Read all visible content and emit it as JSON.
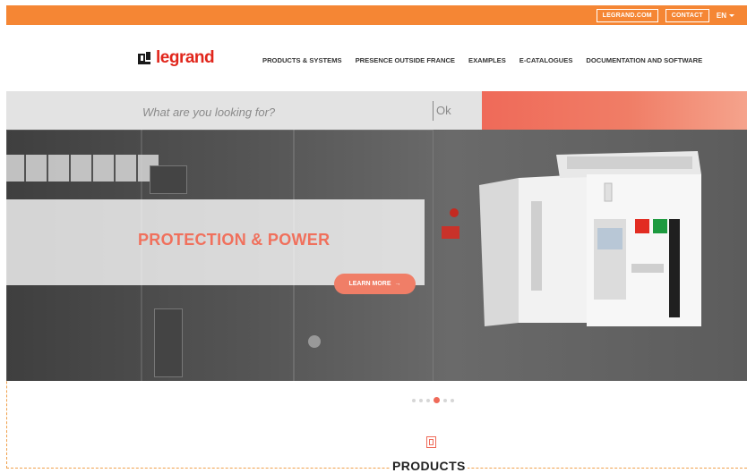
{
  "topbar": {
    "links": [
      "LEGRAND.COM",
      "CONTACT"
    ],
    "language": "EN"
  },
  "header": {
    "logo_text": "legrand",
    "nav": [
      "PRODUCTS & SYSTEMS",
      "PRESENCE OUTSIDE FRANCE",
      "EXAMPLES",
      "E-CATALOGUES",
      "DOCUMENTATION AND SOFTWARE"
    ]
  },
  "search": {
    "placeholder": "What are you looking for?",
    "button_label": "Ok"
  },
  "hero": {
    "title": "PROTECTION & POWER",
    "cta_label": "LEARN MORE",
    "cta_arrow": "→"
  },
  "carousel": {
    "slide_count": 6,
    "active_index": 3
  },
  "section": {
    "title": "PRODUCTS"
  },
  "colors": {
    "topbar": "#f58634",
    "brand_red": "#e1261c",
    "accent": "#ef6a59"
  },
  "icons": {
    "logo": "legrand-logo-icon",
    "lang_caret": "chevron-down-icon",
    "products": "products-icon"
  }
}
